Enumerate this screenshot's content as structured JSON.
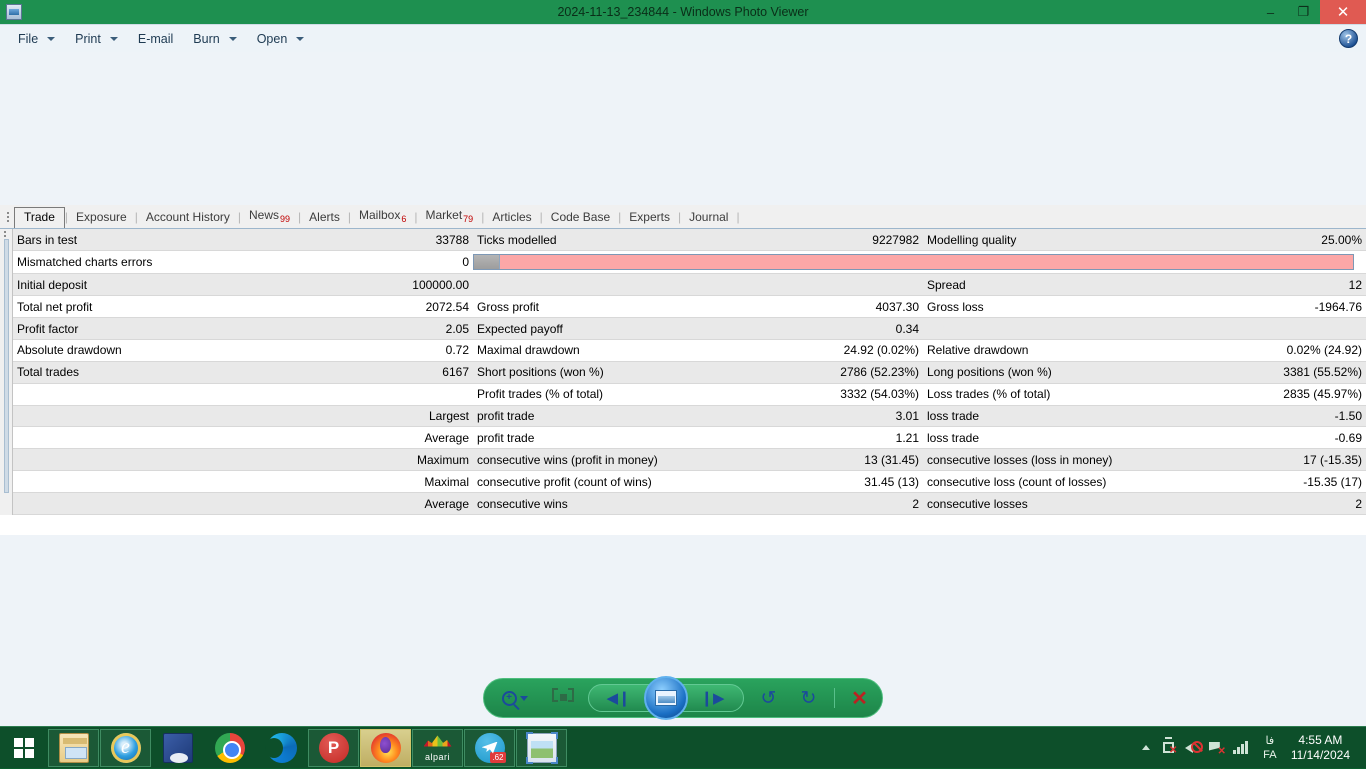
{
  "window": {
    "title": "2024-11-13_234844 - Windows Photo Viewer",
    "icon": "photo-viewer-icon",
    "minimize_label": "–",
    "maximize_label": "❐",
    "close_label": "✕"
  },
  "menu": {
    "items": [
      {
        "label": "File",
        "has_caret": true
      },
      {
        "label": "Print",
        "has_caret": true
      },
      {
        "label": "E-mail",
        "has_caret": false
      },
      {
        "label": "Burn",
        "has_caret": true
      },
      {
        "label": "Open",
        "has_caret": true
      }
    ],
    "help_label": "?"
  },
  "tabs": {
    "items": [
      {
        "label": "Trade",
        "badge": "",
        "active": true
      },
      {
        "label": "Exposure",
        "badge": "",
        "active": false
      },
      {
        "label": "Account History",
        "badge": "",
        "active": false
      },
      {
        "label": "News",
        "badge": "99",
        "active": false
      },
      {
        "label": "Alerts",
        "badge": "",
        "active": false
      },
      {
        "label": "Mailbox",
        "badge": "6",
        "active": false
      },
      {
        "label": "Market",
        "badge": "79",
        "active": false
      },
      {
        "label": "Articles",
        "badge": "",
        "active": false
      },
      {
        "label": "Code Base",
        "badge": "",
        "active": false
      },
      {
        "label": "Experts",
        "badge": "",
        "active": false
      },
      {
        "label": "Journal",
        "badge": "",
        "active": false
      }
    ],
    "separator": "|"
  },
  "report": {
    "quality_bar": {
      "gray_percent": 3,
      "pink_percent": 97
    },
    "rows": [
      {
        "c1": "Bars in test",
        "c2": "33788",
        "c3": "Ticks modelled",
        "c4": "9227982",
        "c5": "Modelling quality",
        "c6": "25.00%"
      },
      {
        "c1": "Mismatched charts errors",
        "c2": "0",
        "c3": "",
        "c4": "",
        "c5": "",
        "c6": "",
        "quality_bar": true
      },
      {
        "c1": "Initial deposit",
        "c2": "100000.00",
        "c3": "",
        "c4": "",
        "c5": "Spread",
        "c6": "12"
      },
      {
        "c1": "Total net profit",
        "c2": "2072.54",
        "c3": "Gross profit",
        "c4": "4037.30",
        "c5": "Gross loss",
        "c6": "-1964.76"
      },
      {
        "c1": "Profit factor",
        "c2": "2.05",
        "c3": "Expected payoff",
        "c4": "0.34",
        "c5": "",
        "c6": ""
      },
      {
        "c1": "Absolute drawdown",
        "c2": "0.72",
        "c3": "Maximal drawdown",
        "c4": "24.92 (0.02%)",
        "c5": "Relative drawdown",
        "c6": "0.02% (24.92)"
      },
      {
        "c1": "Total trades",
        "c2": "6167",
        "c3": "Short positions (won %)",
        "c4": "2786 (52.23%)",
        "c5": "Long positions (won %)",
        "c6": "3381 (55.52%)"
      },
      {
        "c1": "",
        "c2": "",
        "c3": "Profit trades (% of total)",
        "c4": "3332 (54.03%)",
        "c5": "Loss trades (% of total)",
        "c6": "2835 (45.97%)"
      },
      {
        "c1": "",
        "c2": "Largest",
        "c3": "profit trade",
        "c4": "3.01",
        "c5": "loss trade",
        "c6": "-1.50"
      },
      {
        "c1": "",
        "c2": "Average",
        "c3": "profit trade",
        "c4": "1.21",
        "c5": "loss trade",
        "c6": "-0.69"
      },
      {
        "c1": "",
        "c2": "Maximum",
        "c3": "consecutive wins (profit in money)",
        "c4": "13 (31.45)",
        "c5": "consecutive losses (loss in money)",
        "c6": "17 (-15.35)"
      },
      {
        "c1": "",
        "c2": "Maximal",
        "c3": "consecutive profit (count of wins)",
        "c4": "31.45 (13)",
        "c5": "consecutive loss (count of losses)",
        "c6": "-15.35 (17)"
      },
      {
        "c1": "",
        "c2": "Average",
        "c3": "consecutive wins",
        "c4": "2",
        "c5": "consecutive losses",
        "c6": "2"
      }
    ]
  },
  "viewer_toolbar": {
    "zoom_label": "+",
    "buttons": [
      {
        "name": "zoom-button",
        "label": "zoom"
      },
      {
        "name": "actual-size-button",
        "label": "actual size"
      },
      {
        "name": "previous-button",
        "label": "◀❙"
      },
      {
        "name": "play-slideshow-button",
        "label": "slideshow"
      },
      {
        "name": "next-button",
        "label": "❙▶"
      },
      {
        "name": "rotate-counterclockwise-button",
        "label": "↺"
      },
      {
        "name": "rotate-clockwise-button",
        "label": "↻"
      },
      {
        "name": "delete-button",
        "label": "✕"
      }
    ]
  },
  "taskbar": {
    "start_label": "Start",
    "items": [
      {
        "name": "file-explorer",
        "icon": "folder-icon",
        "state": "open"
      },
      {
        "name": "internet-explorer",
        "icon": "ie-icon",
        "state": "open"
      },
      {
        "name": "java-app",
        "icon": "monitor-icon",
        "state": "pinned"
      },
      {
        "name": "google-chrome",
        "icon": "chrome-icon",
        "state": "pinned"
      },
      {
        "name": "microsoft-edge",
        "icon": "edge-icon",
        "state": "pinned"
      },
      {
        "name": "p-app",
        "icon": "p-icon",
        "state": "open"
      },
      {
        "name": "firefox",
        "icon": "firefox-icon",
        "state": "active"
      },
      {
        "name": "alpari",
        "icon": "alpari-icon",
        "state": "open",
        "caption": "alpari"
      },
      {
        "name": "telegram",
        "icon": "telegram-icon",
        "state": "open",
        "badge": ".62"
      },
      {
        "name": "photo-viewer",
        "icon": "photo-icon",
        "state": "open"
      }
    ],
    "tray": {
      "show_hidden_label": "▲",
      "icons": [
        "battery-icon",
        "volume-muted-icon",
        "network-icon",
        "signal-icon"
      ],
      "language": "فا",
      "language_sub": "FA",
      "time": "4:55 AM",
      "date": "11/14/2024"
    }
  }
}
